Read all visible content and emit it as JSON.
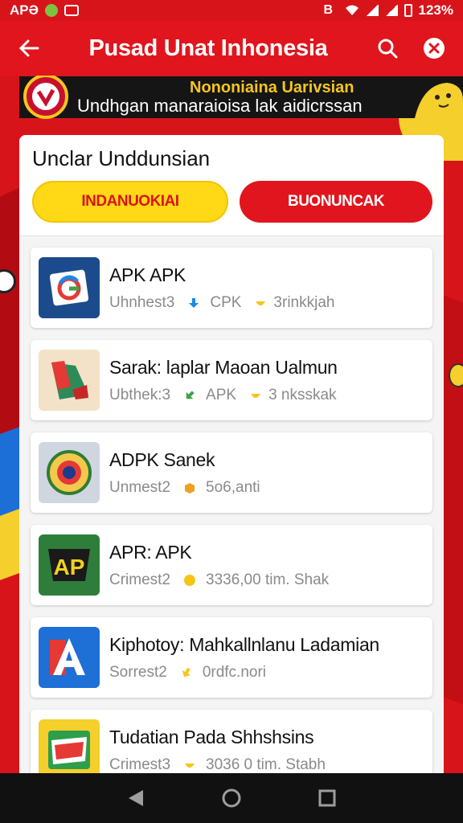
{
  "status_bar": {
    "left_text": "APƏ",
    "battery": "123%"
  },
  "app_bar": {
    "title": "Pusad Unat Inhonesia"
  },
  "banner": {
    "line1": "Nononiaina Uarivsian",
    "line2": "Undhgan manaraioisa lak aidicrssan"
  },
  "panel": {
    "title": "Unclar Unddunsian",
    "button_left": "INDANUOKIAI",
    "button_right": "BUONUNCAK"
  },
  "apps": [
    {
      "name": "APK APK",
      "meta1": "Uhnhest3",
      "meta2": "CPK",
      "meta3": "3rinkkjah",
      "icon": "g-logo-icon"
    },
    {
      "name": "Sarak: laplar Maoan Ualmun",
      "meta1": "Ubthek:3",
      "meta2": "APK",
      "meta3": "3 nksskak",
      "icon": "map-icon"
    },
    {
      "name": "ADPK Sanek",
      "meta1": "Unmest2",
      "meta2": "5o6,anti",
      "meta3": "",
      "icon": "emblem-icon"
    },
    {
      "name": "APR: APK",
      "meta1": "Crimest2",
      "meta2": "3336,00  tim. Shak",
      "meta3": "",
      "icon": "ap-logo-icon"
    },
    {
      "name": "Kiphotoy: Mahkallnlanu Ladamian",
      "meta1": "Sorrest2",
      "meta2": "0rdfc.nori",
      "meta3": "",
      "icon": "a-letter-icon"
    },
    {
      "name": "Tudatian Pada Shhshsins",
      "meta1": "Crimest3",
      "meta2": "3036 0  tim. Stabh",
      "meta3": "",
      "icon": "badge-icon"
    }
  ],
  "colors": {
    "primary_red": "#e0151d",
    "accent_yellow": "#ffd816"
  }
}
